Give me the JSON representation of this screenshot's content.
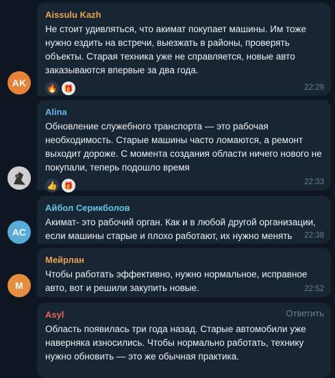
{
  "messages": [
    {
      "sender": "Aissulu Kazh",
      "sender_color": "#e8a24a",
      "text": "Не стоит удивляться, что акимат покупает машины. Им тоже нужно ездить на встречи, выезжать в районы, проверять объекты. Старая техника уже не справляется, новые авто заказываются впервые за два года.",
      "reactions": [
        "🔥",
        "🎁"
      ],
      "time": "22:29",
      "avatar_initials": "AK",
      "avatar_color": "#e78337"
    },
    {
      "sender": "Alina",
      "sender_color": "#5fb7e8",
      "text": "Обновление служебного транспорта — это рабочая необходимость. Старые машины часто ломаются, а ремонт выходит дороже. С момента создания области ничего нового не покупали, теперь подошло время",
      "reactions": [
        "👍",
        "🎁"
      ],
      "time": "22:33",
      "avatar_initials": "",
      "avatar_color": "#d9d9d9"
    },
    {
      "sender": "Айбол Серикболов",
      "sender_color": "#5fc7e8",
      "text": "Акимат- это рабочий орган. Как и в любой другой организации, если машины старые и плохо работают, их нужно менять",
      "reactions": [],
      "time": "22:38",
      "avatar_initials": "АС",
      "avatar_color": "#55acd8"
    },
    {
      "sender": "Мейрлан",
      "sender_color": "#e8a24a",
      "text": "Чтобы работать эффективно, нужно нормальное, исправное авто, вот и решили закупить новые.",
      "reactions": [],
      "time": "22:52",
      "avatar_initials": "М",
      "avatar_color": "#e78d3f"
    },
    {
      "sender": "Asyl",
      "sender_color": "#e8635a",
      "reply_label": "Ответить",
      "text": "Область появилась три года назад. Старые автомобили уже наверняка износились. Чтобы нормально работать, технику нужно обновить — это же обычная практика.",
      "reactions": [],
      "time": "",
      "avatar_initials": "",
      "avatar_color": ""
    }
  ]
}
